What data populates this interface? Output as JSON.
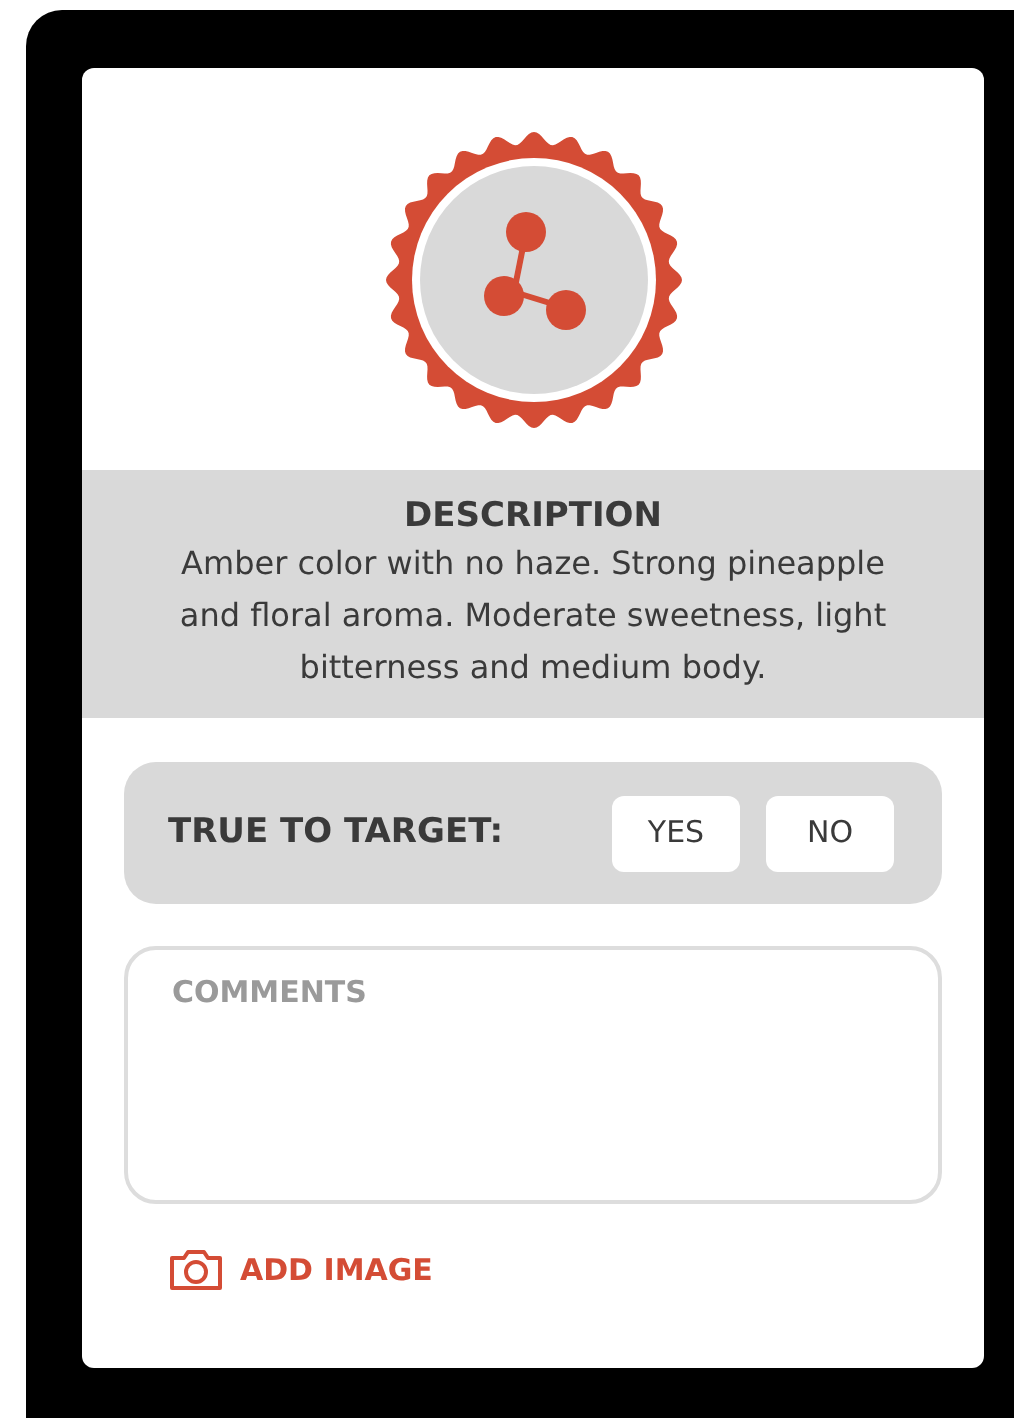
{
  "description": {
    "title": "DESCRIPTION",
    "text": "Amber color with no haze. Strong pineapple and floral aroma. Moderate sweetness, light bitterness and medium body."
  },
  "true_to_target": {
    "label": "TRUE TO TARGET:",
    "options": [
      {
        "label": "YES",
        "selected": false
      },
      {
        "label": "NO",
        "selected": false
      }
    ]
  },
  "comments": {
    "placeholder": "COMMENTS"
  },
  "add_image": {
    "label": "ADD IMAGE"
  }
}
